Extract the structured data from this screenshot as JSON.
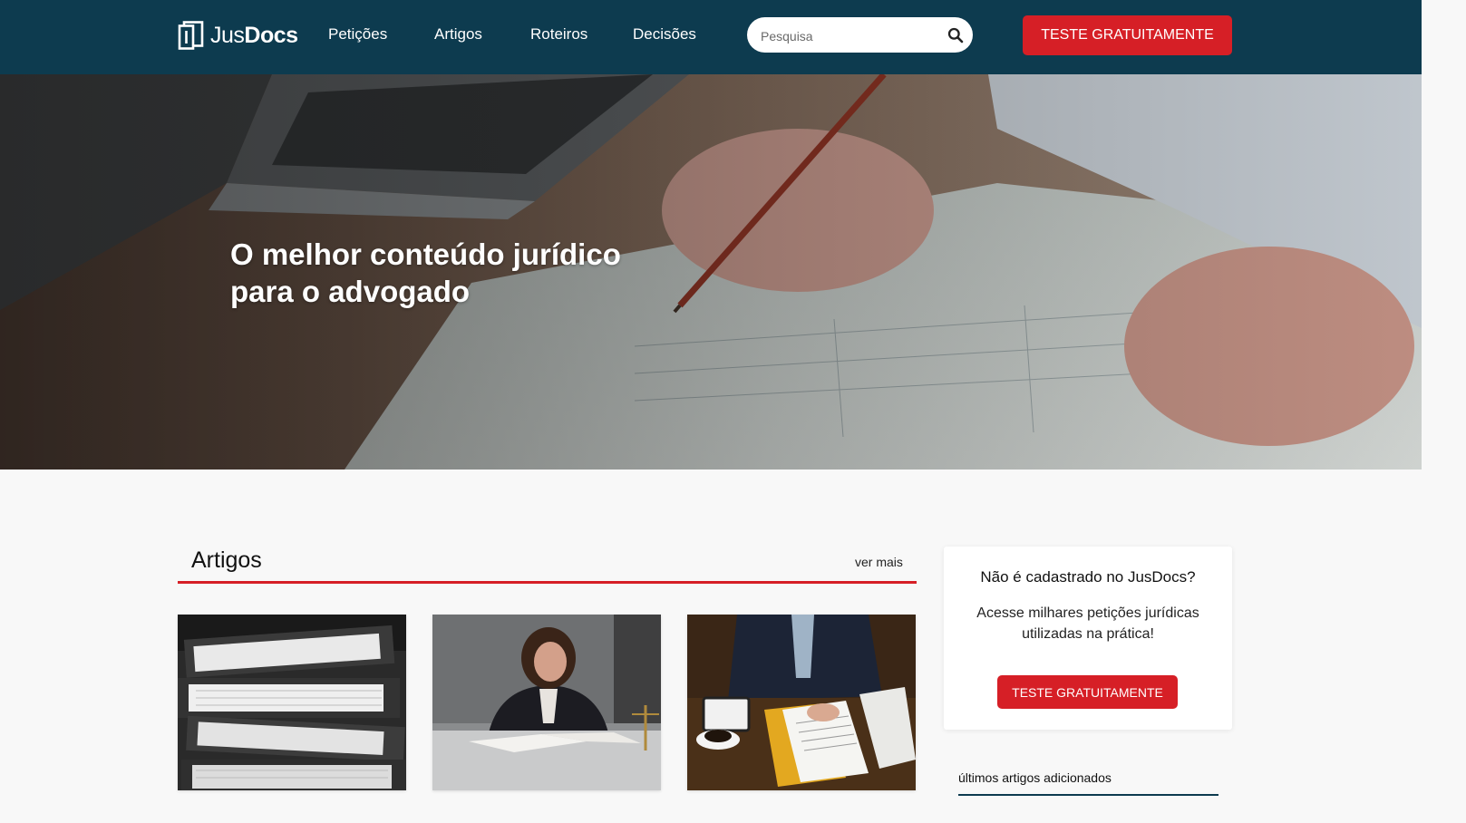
{
  "brand": {
    "name_light": "Jus",
    "name_bold": "Docs",
    "primary_color": "#0d3b4f",
    "accent_color": "#d61f26"
  },
  "nav": {
    "items": [
      {
        "label": "Petições"
      },
      {
        "label": "Artigos"
      },
      {
        "label": "Roteiros"
      },
      {
        "label": "Decisões"
      }
    ]
  },
  "search": {
    "placeholder": "Pesquisa",
    "value": "",
    "icon": "search-icon"
  },
  "header_cta": {
    "label": "TESTE GRATUITAMENTE"
  },
  "hero": {
    "title": "O melhor conteúdo jurídico para o advogado"
  },
  "articles": {
    "title": "Artigos",
    "see_more": "ver mais",
    "cards": [
      {
        "image": "stacked-binders-photo"
      },
      {
        "image": "woman-studying-documents-photo"
      },
      {
        "image": "lawyer-reviewing-papers-photo"
      }
    ]
  },
  "sidebar": {
    "signup_title": "Não é cadastrado no JusDocs?",
    "signup_text": "Acesse milhares petições jurídicas utilizadas na prática!",
    "signup_button": "TESTE GRATUITAMENTE",
    "latest_title": "últimos artigos adicionados"
  }
}
